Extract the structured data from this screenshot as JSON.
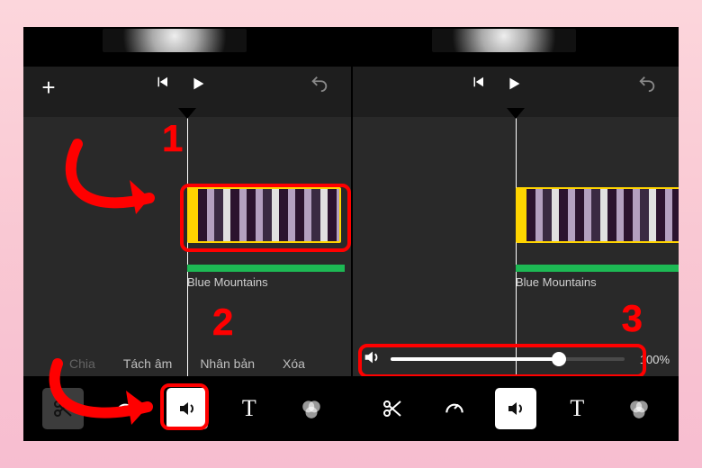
{
  "panels": {
    "left": {
      "track_label": "Blue Mountains",
      "actions": {
        "chia": "Chia",
        "tach_am": "Tách âm",
        "nhan_ban": "Nhân bản",
        "xoa": "Xóa"
      },
      "annotations": {
        "n1": "1",
        "n2": "2"
      },
      "toolbar": {
        "cut": "scissors-icon",
        "speed": "speedometer-icon",
        "volume": "speaker-icon",
        "text_label": "T",
        "filter": "filter-icon"
      }
    },
    "right": {
      "track_label": "Blue Mountains",
      "volume": {
        "value_pct": 72,
        "label": "100%"
      },
      "annotations": {
        "n3": "3"
      },
      "toolbar": {
        "cut": "scissors-icon",
        "speed": "speedometer-icon",
        "volume": "speaker-icon",
        "text_label": "T",
        "filter": "filter-icon"
      }
    }
  },
  "icons": {
    "add": "+",
    "undo": "undo-icon",
    "play": "play-icon",
    "prev": "skip-back-icon",
    "speaker": "speaker-icon"
  },
  "colors": {
    "annotation_red": "#ff0000",
    "clip_selected": "#ffd400",
    "audio_line": "#1db954"
  }
}
